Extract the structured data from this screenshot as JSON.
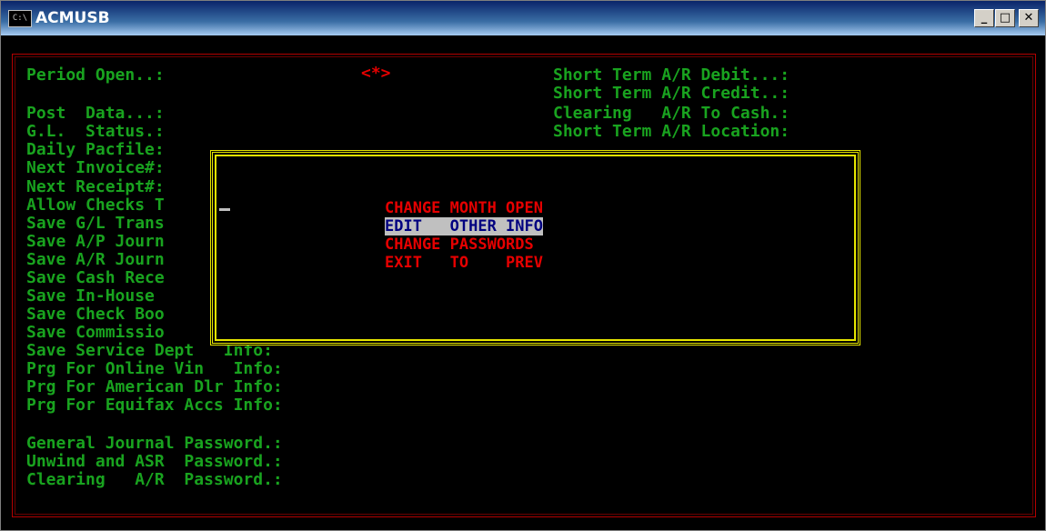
{
  "window": {
    "title": "ACMUSB",
    "icon_text": "C:\\",
    "min_label": "_",
    "max_label": "□",
    "close_label": "✕"
  },
  "left_fields": [
    "Period Open..:",
    "Post  Data...:",
    "G.L.  Status.:",
    "Daily Pacfile:",
    "Next Invoice#:",
    "Next Receipt#:",
    "Allow Checks T",
    "Save G/L Trans",
    "Save A/P Journ",
    "Save A/R Journ",
    "Save Cash Rece",
    "Save In-House ",
    "Save Check Boo",
    "Save Commissio",
    "Save Service Dept   Info:",
    "Prg For Online Vin   Info:",
    "Prg For American Dlr Info:",
    "Prg For Equifax Accs Info:",
    "General Journal Password.:",
    "Unwind and ASR  Password.:",
    "Clearing   A/R  Password.:"
  ],
  "period_marker": "<*>",
  "right_fields": [
    "Short Term A/R Debit...:",
    "Short Term A/R Credit..:",
    "Clearing   A/R To Cash.:",
    "Short Term A/R Location:"
  ],
  "menu": {
    "items": [
      "CHANGE MONTH OPEN",
      "EDIT   OTHER INFO",
      "CHANGE PASSWORDS",
      "EXIT   TO    PREV"
    ],
    "selected_index": 1
  },
  "colors": {
    "field_text": "#19a31f",
    "menu_text": "#e60000",
    "highlight_bg": "#c0c0c0",
    "highlight_text": "#000080",
    "popup_border": "#e6e600",
    "frame": "#b30000"
  }
}
